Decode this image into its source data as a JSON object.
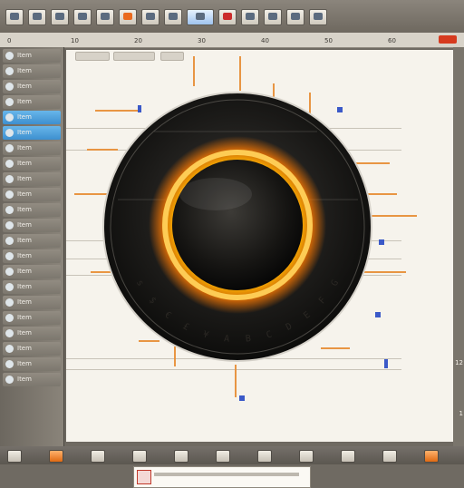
{
  "toolbar": {
    "buttons": [
      {
        "name": "toolbar-button-1",
        "icon": "window-icon",
        "selected": false
      },
      {
        "name": "toolbar-button-2",
        "icon": "grid-icon",
        "selected": false
      },
      {
        "name": "toolbar-button-3",
        "icon": "layers-icon",
        "selected": false
      },
      {
        "name": "toolbar-button-4",
        "icon": "image-icon",
        "selected": false
      },
      {
        "name": "toolbar-button-5",
        "icon": "document-icon",
        "selected": false
      },
      {
        "name": "toolbar-button-6",
        "icon": "orange-square-icon",
        "selected": false,
        "accent": "orange"
      },
      {
        "name": "toolbar-button-7",
        "icon": "tool-icon",
        "selected": false
      },
      {
        "name": "toolbar-button-8",
        "icon": "tool-icon",
        "selected": false
      },
      {
        "name": "toolbar-button-9",
        "icon": "panel-icon",
        "selected": true
      },
      {
        "name": "toolbar-button-10",
        "icon": "red-square-icon",
        "selected": false,
        "accent": "red"
      },
      {
        "name": "toolbar-button-11",
        "icon": "settings-icon",
        "selected": false
      },
      {
        "name": "toolbar-button-12",
        "icon": "settings-icon",
        "selected": false
      },
      {
        "name": "toolbar-button-13",
        "icon": "search-icon",
        "selected": false
      },
      {
        "name": "toolbar-button-14",
        "icon": "menu-icon",
        "selected": false
      }
    ]
  },
  "ruler": {
    "ticks": [
      {
        "label": "0"
      },
      {
        "label": "10"
      },
      {
        "label": "20"
      },
      {
        "label": "30"
      },
      {
        "label": "40"
      },
      {
        "label": "50"
      },
      {
        "label": "60"
      }
    ]
  },
  "sidebar": {
    "items": [
      {
        "label": "Item"
      },
      {
        "label": "Item"
      },
      {
        "label": "Item"
      },
      {
        "label": "Item"
      },
      {
        "label": "Item",
        "highlight": true
      },
      {
        "label": "Item",
        "highlight": true
      },
      {
        "label": "Item"
      },
      {
        "label": "Item"
      },
      {
        "label": "Item"
      },
      {
        "label": "Item"
      },
      {
        "label": "Item"
      },
      {
        "label": "Item"
      },
      {
        "label": "Item"
      },
      {
        "label": "Item"
      },
      {
        "label": "Item"
      },
      {
        "label": "Item"
      },
      {
        "label": "Item"
      },
      {
        "label": "Item"
      },
      {
        "label": "Item"
      },
      {
        "label": "Item"
      },
      {
        "label": "Item"
      },
      {
        "label": "Item"
      }
    ]
  },
  "rightbar": {
    "numbers": [
      "12",
      "1"
    ]
  },
  "statusbar": {
    "buttons": [
      {
        "name": "status-button-1"
      },
      {
        "name": "status-button-2",
        "accent": "orange"
      },
      {
        "name": "status-button-3"
      },
      {
        "name": "status-button-4"
      },
      {
        "name": "status-button-5"
      },
      {
        "name": "status-button-6"
      },
      {
        "name": "status-button-7"
      },
      {
        "name": "status-button-8"
      },
      {
        "name": "status-button-9"
      },
      {
        "name": "status-button-10"
      },
      {
        "name": "status-button-11",
        "accent": "orange"
      }
    ]
  },
  "colors": {
    "accent_orange": "#e87a24",
    "ring_glow": "#ffb000",
    "disc_dark": "#1c1b19",
    "canvas_bg": "#f6f3ec",
    "highlight_blue": "#3d8fcf"
  },
  "lens": {
    "ring_text": [
      {
        "text": "s"
      },
      {
        "text": "$"
      },
      {
        "text": "€"
      },
      {
        "text": "£"
      },
      {
        "text": "¥"
      },
      {
        "text": "A"
      },
      {
        "text": "B"
      },
      {
        "text": "C"
      },
      {
        "text": "D"
      },
      {
        "text": "E"
      },
      {
        "text": "F"
      },
      {
        "text": "G"
      }
    ]
  }
}
